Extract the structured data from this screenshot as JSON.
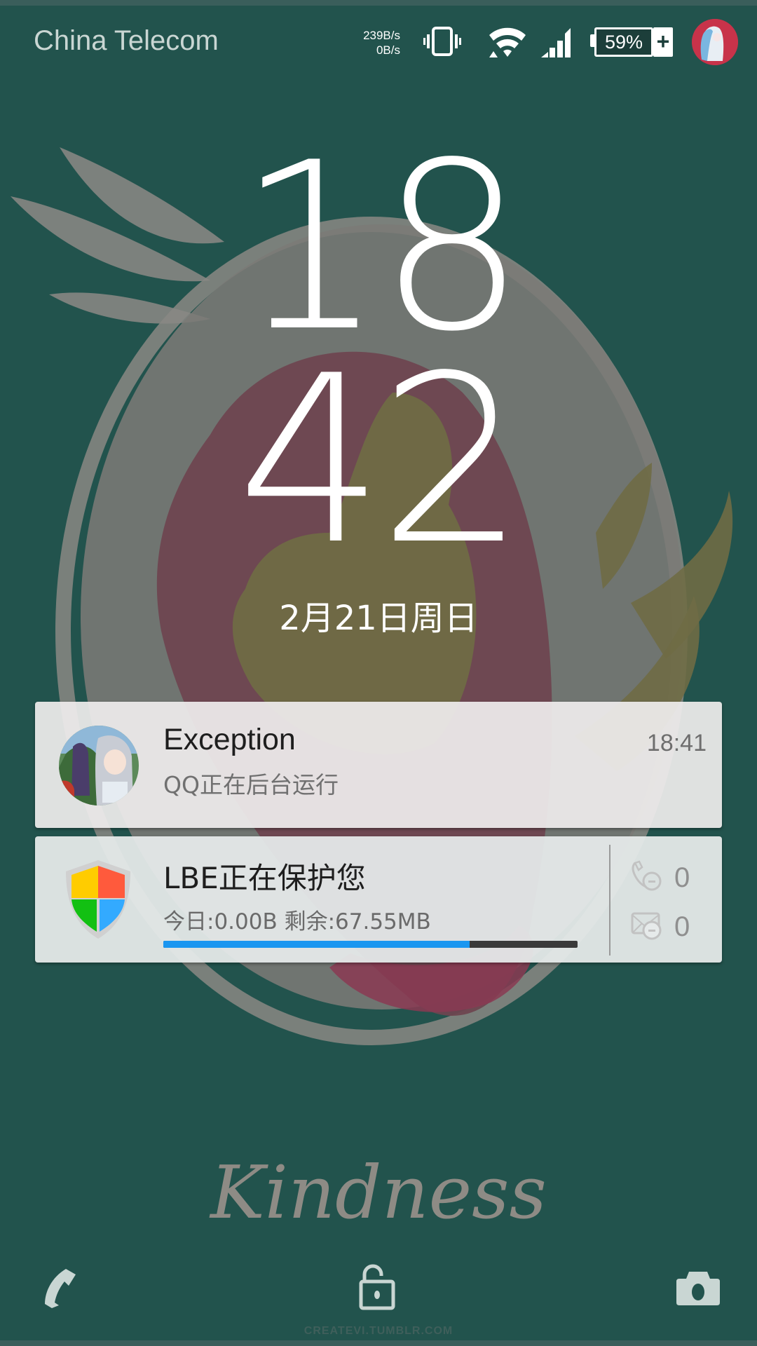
{
  "status_bar": {
    "carrier": "China Telecom",
    "net_up": "239B/s",
    "net_down": "0B/s",
    "icons": [
      "vibrate-icon",
      "wifi-icon",
      "signal-icon",
      "battery-icon",
      "user-avatar"
    ],
    "battery_percent": "59%",
    "battery_level": 59,
    "charging_symbol": "+"
  },
  "clock": {
    "hours": "18",
    "minutes": "42",
    "date": "2月21日周日"
  },
  "notifications": [
    {
      "app": "QQ",
      "title": "Exception",
      "subtitle": "QQ正在后台运行",
      "time": "18:41"
    },
    {
      "app": "LBE",
      "title": "LBE正在保护您",
      "subtitle": "今日:0.00B 剩余:67.55MB",
      "progress_fraction": 0.74,
      "blocked_calls": "0",
      "blocked_messages": "0",
      "colors": {
        "progress": "#1a96f0",
        "track": "#3a3a3a"
      }
    }
  ],
  "wallpaper": {
    "caption": "Kindness",
    "credit": "CREATEVI.TUMBLR.COM"
  },
  "bottom_actions": {
    "phone": "phone-icon",
    "unlock": "unlock-icon",
    "camera": "camera-icon"
  },
  "colors": {
    "background": "#22534d",
    "text_light": "#ffffff",
    "carrier_text": "#c9d6d3"
  }
}
